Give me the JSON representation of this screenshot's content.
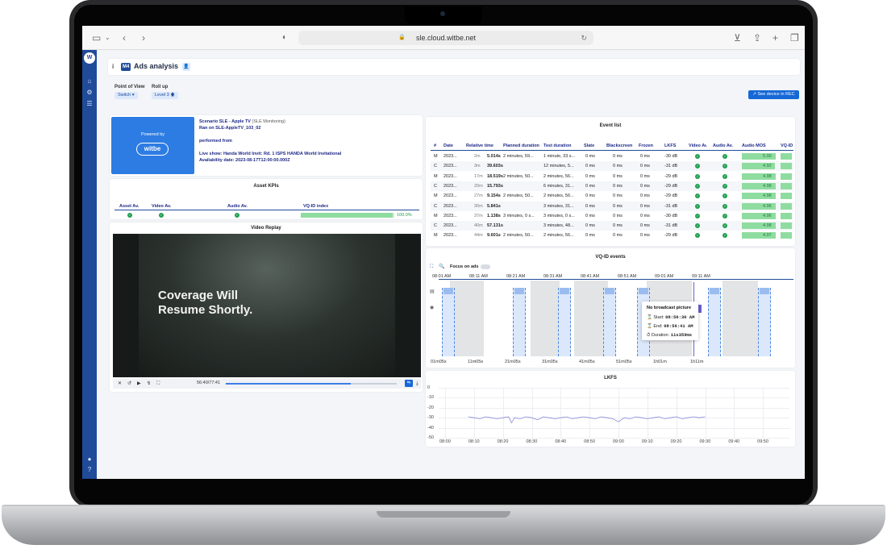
{
  "browser": {
    "url": "sle.cloud.witbe.net",
    "icons": [
      "sidebar-icon",
      "chevron-down-icon",
      "back-icon",
      "forward-icon",
      "shield-icon",
      "lock-icon",
      "reload-icon",
      "download-icon",
      "share-icon",
      "plus-icon",
      "tabs-icon"
    ]
  },
  "sidebar": {
    "logo": "W",
    "icons": [
      "home-icon",
      "gear-icon",
      "list-icon",
      "user-icon",
      "help-icon"
    ]
  },
  "header": {
    "info": "i",
    "badge": "M4",
    "title": "Ads analysis",
    "person": "👤"
  },
  "controls": {
    "point_of_view_label": "Point of View",
    "point_of_view_value": "Switch ▾",
    "roll_up_label": "Roll up",
    "roll_up_value": "Level 3 🡅",
    "see_device_label": "↗ See device in REC"
  },
  "scenario": {
    "powered_by": "Powered by",
    "logo_text": "witbe",
    "title": "Scenario SLE - Apple TV",
    "title_suffix": "(SLE Monitoring)",
    "ran_on": "Ran on SLE-AppleTV_103_02",
    "performed_from": "performed from",
    "live_show": "Live show: Handa World Invit: Rd. 1 ISPS HANDA World Invitational",
    "availability": "Availability date: 2023-08-17T12:00:00.000Z"
  },
  "asset_kpis": {
    "title": "Asset KPIs",
    "headers": [
      "Asset Av.",
      "Video Av.",
      "Audio Av.",
      "VQ-ID index"
    ],
    "vq_value": "100.0%",
    "vq_fraction": 0.98
  },
  "video_replay": {
    "title": "Video Replay",
    "overlay_line1": "Coverage Will",
    "overlay_line2": "Resume Shortly.",
    "time": "56:40/77:41",
    "progress": 0.73
  },
  "event_list": {
    "title": "Event list",
    "headers": [
      "#",
      "Date",
      "Relative time",
      "Planned duration",
      "Test duration",
      "Slate",
      "Blackscreen",
      "Frozen",
      "LKFS",
      "Video Av.",
      "Audio Av.",
      "Audio MOS",
      "VQ-ID"
    ],
    "rows": [
      {
        "type": "M",
        "date": "2023...",
        "rel_min": "2m",
        "rel_s": "5.014s",
        "planned": "2 minutes, 59...",
        "test": "1 minute, 33 s...",
        "slate": "0 ms",
        "black": "0 ms",
        "frozen": "0 ms",
        "lkfs": "-30 dB",
        "mos": "5.00",
        "mos_f": 1.0
      },
      {
        "type": "C",
        "date": "2023...",
        "rel_min": "3m",
        "rel_s": "39.603s",
        "planned": "",
        "test": "12 minutes, 5...",
        "slate": "0 ms",
        "black": "0 ms",
        "frozen": "0 ms",
        "lkfs": "-31 dB",
        "mos": "4.92",
        "mos_f": 0.98
      },
      {
        "type": "M",
        "date": "2023...",
        "rel_min": "17m",
        "rel_s": "18.519s",
        "planned": "2 minutes, 50...",
        "test": "2 minutes, 56...",
        "slate": "0 ms",
        "black": "0 ms",
        "frozen": "0 ms",
        "lkfs": "-29 dB",
        "mos": "4.98",
        "mos_f": 0.99
      },
      {
        "type": "C",
        "date": "2023...",
        "rel_min": "20m",
        "rel_s": "15.793s",
        "planned": "",
        "test": "6 minutes, 31...",
        "slate": "0 ms",
        "black": "0 ms",
        "frozen": "0 ms",
        "lkfs": "-29 dB",
        "mos": "4.98",
        "mos_f": 0.99
      },
      {
        "type": "M",
        "date": "2023...",
        "rel_min": "27m",
        "rel_s": "9.154s",
        "planned": "2 minutes, 50...",
        "test": "2 minutes, 56...",
        "slate": "0 ms",
        "black": "0 ms",
        "frozen": "0 ms",
        "lkfs": "-29 dB",
        "mos": "4.98",
        "mos_f": 0.99
      },
      {
        "type": "C",
        "date": "2023...",
        "rel_min": "30m",
        "rel_s": "5.841s",
        "planned": "",
        "test": "3 minutes, 31...",
        "slate": "0 ms",
        "black": "0 ms",
        "frozen": "0 ms",
        "lkfs": "-31 dB",
        "mos": "4.96",
        "mos_f": 0.99
      },
      {
        "type": "M",
        "date": "2023...",
        "rel_min": "37m",
        "rel_s": "1.138s",
        "planned": "3 minutes, 0 s...",
        "test": "3 minutes, 0 s...",
        "slate": "0 ms",
        "black": "0 ms",
        "frozen": "0 ms",
        "lkfs": "-30 dB",
        "mos": "4.96",
        "mos_f": 0.99
      },
      {
        "type": "C",
        "date": "2023...",
        "rel_min": "40m",
        "rel_s": "57.131s",
        "planned": "",
        "test": "3 minutes, 48...",
        "slate": "0 ms",
        "black": "0 ms",
        "frozen": "0 ms",
        "lkfs": "-31 dB",
        "mos": "4.98",
        "mos_f": 0.99
      },
      {
        "type": "M",
        "date": "2023...",
        "rel_min": "44m",
        "rel_s": "9.601s",
        "planned": "2 minutes, 50...",
        "test": "2 minutes, 56...",
        "slate": "0 ms",
        "black": "0 ms",
        "frozen": "0 ms",
        "lkfs": "-29 dB",
        "mos": "4.97",
        "mos_f": 0.99
      }
    ]
  },
  "vqid_events": {
    "title": "VQ-ID events",
    "focus_label": "Focus on ads",
    "top_ticks": [
      "08:01 AM",
      "08:11 AM",
      "08:21 AM",
      "08:31 AM",
      "08:41 AM",
      "08:51 AM",
      "09:01 AM",
      "09:11 AM"
    ],
    "bottom_ticks": [
      "01m05s",
      "11m05s",
      "21m05s",
      "31m05s",
      "41m05s",
      "51m05s",
      "1h01m",
      "1h11m"
    ],
    "tooltip": {
      "title": "No broadcast picture",
      "start_label": "Start:",
      "start": "08:56:30 AM",
      "end_label": "End:",
      "end": "08:56:41 AM",
      "duration_label": "Duration:",
      "duration": "11s359ms"
    }
  },
  "chart_data": {
    "type": "line",
    "title": "LKFS",
    "xlabel": "",
    "ylabel": "",
    "x_ticks": [
      "08:00",
      "08:10",
      "08:20",
      "08:30",
      "08:40",
      "08:50",
      "09:00",
      "09:10",
      "09:20",
      "09:30",
      "09:40",
      "09:50"
    ],
    "ylim": [
      -50,
      0
    ],
    "y_ticks": [
      0,
      -10,
      -20,
      -30,
      -40,
      -50
    ],
    "series": [
      {
        "color": "#8b86d8",
        "x_minutes": [
          8,
          10,
          12,
          14,
          16,
          18,
          20,
          22,
          23,
          24,
          26,
          28,
          30,
          32,
          34,
          36,
          38,
          40,
          42,
          44,
          46,
          48,
          50,
          52,
          54,
          56,
          58,
          60,
          62,
          64,
          66,
          68,
          70,
          72,
          74,
          76,
          78,
          80,
          82,
          84,
          86,
          88,
          90
        ],
        "values": [
          -29,
          -30,
          -31,
          -29,
          -30,
          -31,
          -30,
          -29,
          -35,
          -30,
          -31,
          -29,
          -30,
          -32,
          -29,
          -30,
          -31,
          -30,
          -29,
          -31,
          -30,
          -29,
          -30,
          -31,
          -29,
          -30,
          -31,
          -34,
          -30,
          -31,
          -29,
          -30,
          -31,
          -30,
          -29,
          -31,
          -30,
          -29,
          -31,
          -30,
          -29,
          -30,
          -29
        ]
      }
    ]
  }
}
